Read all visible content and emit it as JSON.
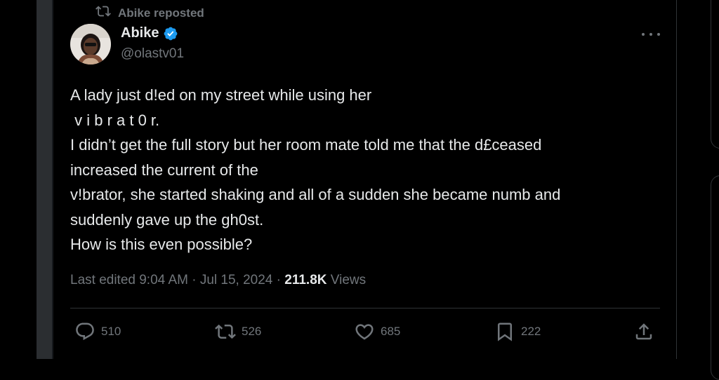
{
  "repost": {
    "text": "Abike reposted"
  },
  "author": {
    "name": "Abike",
    "handle": "@olastv01"
  },
  "tweet": {
    "lines": [
      "A lady just d!ed on my street while using her",
      " v i b r a t 0 r.",
      "I didn’t get the full story but her room mate told me that the d£ceased",
      "increased the current of the",
      "v!brator, she started shaking and all of a sudden she became numb and",
      "suddenly gave up the gh0st.",
      "How is this even possible?"
    ]
  },
  "meta": {
    "edited": "Last edited 9:04 AM",
    "sep1": " · ",
    "date": "Jul 15, 2024",
    "sep2": " · ",
    "views_count": "211.8K",
    "views_label": " Views"
  },
  "actions": {
    "replies": "510",
    "reposts": "526",
    "likes": "685",
    "bookmarks": "222"
  },
  "icons": [
    "repost-icon",
    "verified-badge-icon",
    "more-icon",
    "reply-icon",
    "like-icon",
    "bookmark-icon",
    "share-icon"
  ],
  "colors": {
    "background": "#000000",
    "text": "#e7e9ea",
    "secondary": "#71767b",
    "verified": "#1d9bf0",
    "divider": "#2f3336"
  }
}
